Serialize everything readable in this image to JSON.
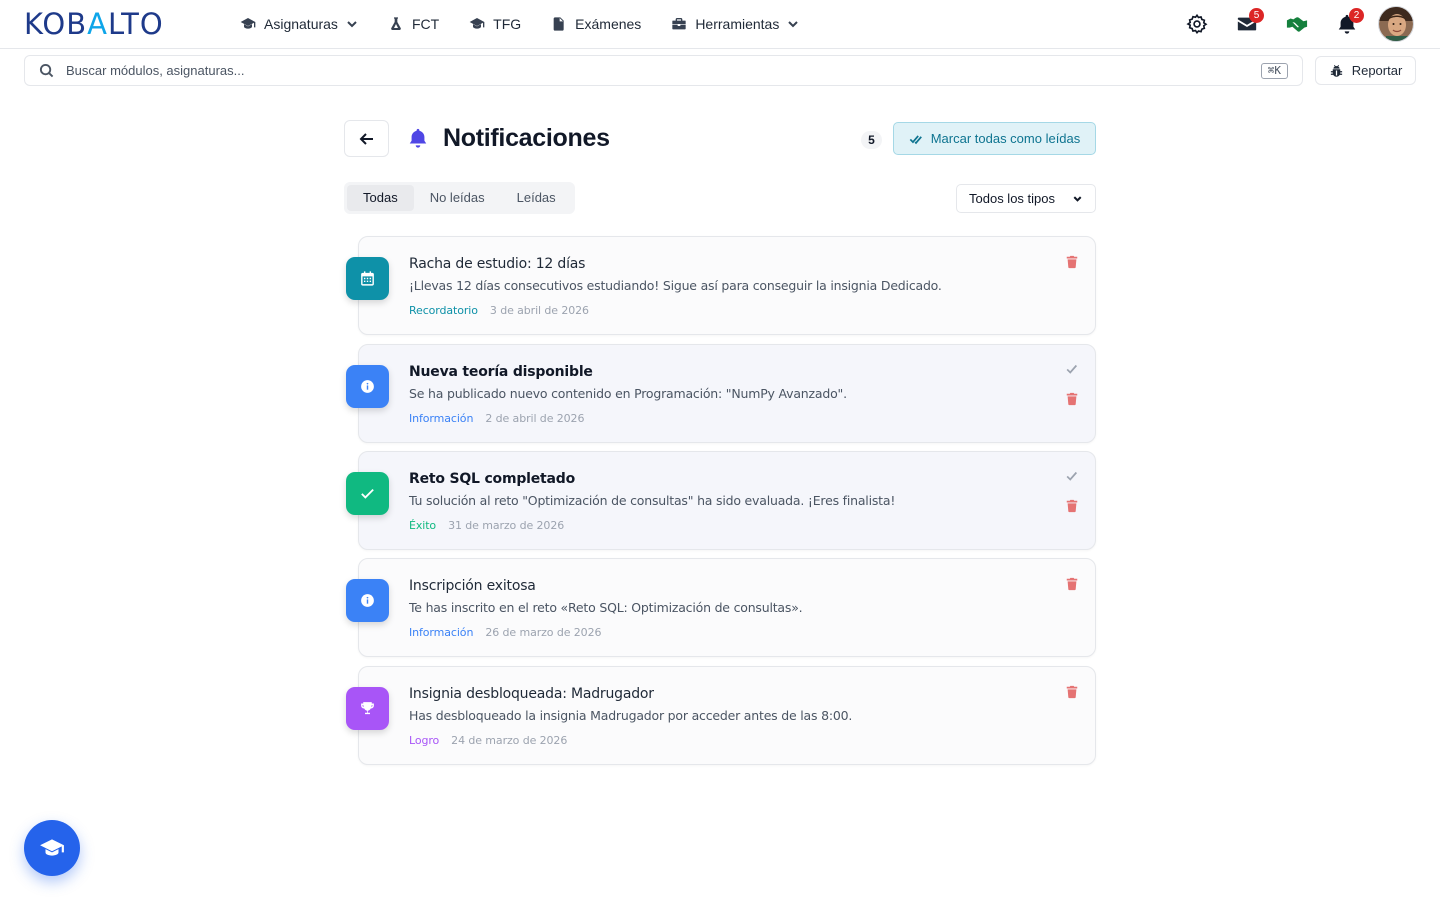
{
  "app": {
    "logo_text": "KOBALTO"
  },
  "nav": {
    "items": [
      {
        "label": "Asignaturas",
        "icon": "graduation-cap-icon",
        "dropdown": true
      },
      {
        "label": "FCT",
        "icon": "flask-icon",
        "dropdown": false
      },
      {
        "label": "TFG",
        "icon": "graduation-cap-icon",
        "dropdown": false
      },
      {
        "label": "Exámenes",
        "icon": "file-icon",
        "dropdown": false
      },
      {
        "label": "Herramientas",
        "icon": "toolbox-icon",
        "dropdown": true
      }
    ],
    "messages_badge": "5",
    "notifications_badge": "2"
  },
  "search": {
    "placeholder": "Buscar módulos, asignaturas...",
    "shortcut": "⌘K"
  },
  "report_label": "Reportar",
  "header": {
    "title": "Notificaciones",
    "count": "5",
    "mark_all_label": "Marcar todas como leídas"
  },
  "tabs": [
    {
      "label": "Todas",
      "active": true
    },
    {
      "label": "No leídas",
      "active": false
    },
    {
      "label": "Leídas",
      "active": false
    }
  ],
  "type_filter": {
    "selected": "Todos los tipos"
  },
  "notifications": [
    {
      "title": "Racha de estudio: 12 días",
      "message": "¡Llevas 12 días consecutivos estudiando! Sigue así para conseguir la insignia Dedicado.",
      "type": "Recordatorio",
      "date": "3 de abril de 2026",
      "unread": false,
      "icon": "calendar-icon",
      "color": "#0e91a8"
    },
    {
      "title": "Nueva teoría disponible",
      "message": "Se ha publicado nuevo contenido en Programación: \"NumPy Avanzado\".",
      "type": "Información",
      "date": "2 de abril de 2026",
      "unread": true,
      "icon": "info-icon",
      "color": "#3b82f6"
    },
    {
      "title": "Reto SQL completado",
      "message": "Tu solución al reto \"Optimización de consultas\" ha sido evaluada. ¡Eres finalista!",
      "type": "Éxito",
      "date": "31 de marzo de 2026",
      "unread": true,
      "icon": "check-icon",
      "color": "#10b981"
    },
    {
      "title": "Inscripción exitosa",
      "message": "Te has inscrito en el reto «Reto SQL: Optimización de consultas».",
      "type": "Información",
      "date": "26 de marzo de 2026",
      "unread": false,
      "icon": "info-icon",
      "color": "#3b82f6"
    },
    {
      "title": "Insignia desbloqueada: Madrugador",
      "message": "Has desbloqueado la insignia Madrugador por acceder antes de las 8:00.",
      "type": "Logro",
      "date": "24 de marzo de 2026",
      "unread": false,
      "icon": "trophy-icon",
      "color": "#a855f7"
    }
  ]
}
